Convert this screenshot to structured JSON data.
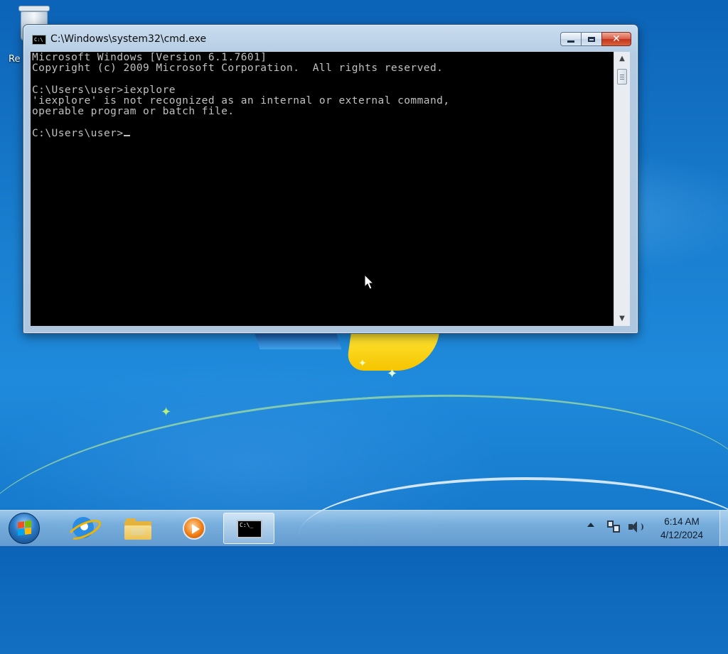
{
  "desktop": {
    "icons": [
      {
        "icon": "recycle-bin-icon",
        "label": "Re"
      }
    ]
  },
  "window": {
    "title": "C:\\Windows\\system32\\cmd.exe",
    "icon": "cmd-icon",
    "console": {
      "lines": [
        "Microsoft Windows [Version 6.1.7601]",
        "Copyright (c) 2009 Microsoft Corporation.  All rights reserved.",
        "",
        "C:\\Users\\user>iexplore",
        "'iexplore' is not recognized as an internal or external command,",
        "operable program or batch file.",
        "",
        "C:\\Users\\user>"
      ],
      "background": "#000000",
      "foreground": "#c0c0c0"
    }
  },
  "taskbar": {
    "pinned": [
      {
        "icon": "start-orb-icon",
        "active": false
      },
      {
        "icon": "internet-explorer-icon",
        "active": false
      },
      {
        "icon": "file-explorer-icon",
        "active": false
      },
      {
        "icon": "windows-media-player-icon",
        "active": false
      },
      {
        "icon": "command-prompt-icon",
        "active": true,
        "glyph": "C:\\_"
      }
    ],
    "tray": {
      "icons": [
        "show-hidden-icons-icon",
        "network-icon",
        "volume-icon"
      ],
      "time": "6:14 AM",
      "date": "4/12/2024"
    }
  },
  "colors": {
    "accent": "#1a7fd0",
    "close_button": "#c2341c",
    "console_bg": "#000000"
  }
}
